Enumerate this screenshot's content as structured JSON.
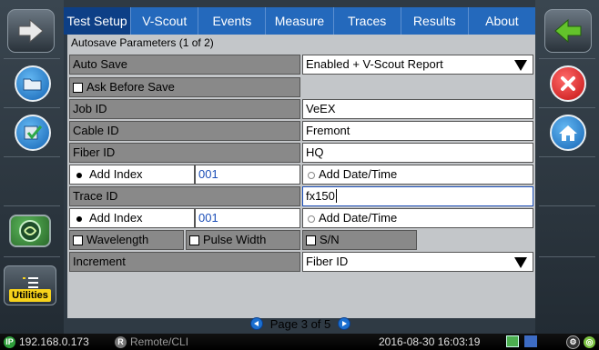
{
  "tabs": [
    "Test Setup",
    "V-Scout",
    "Events",
    "Measure",
    "Traces",
    "Results",
    "About"
  ],
  "section_title": "Autosave Parameters (1 of 2)",
  "auto_save": {
    "label": "Auto Save",
    "value": "Enabled + V-Scout Report"
  },
  "ask_before_save": {
    "label": "Ask Before Save"
  },
  "job_id": {
    "label": "Job ID",
    "value": "VeEX"
  },
  "cable_id": {
    "label": "Cable ID",
    "value": "Fremont"
  },
  "fiber_id": {
    "label": "Fiber ID",
    "value": "HQ"
  },
  "fiber_index": {
    "label": "Add Index",
    "value": "001",
    "date_label": "Add Date/Time"
  },
  "trace_id": {
    "label": "Trace ID",
    "value": "fx150"
  },
  "trace_index": {
    "label": "Add Index",
    "value": "001",
    "date_label": "Add Date/Time"
  },
  "options": {
    "wavelength": "Wavelength",
    "pulse_width": "Pulse Width",
    "sn": "S/N"
  },
  "increment": {
    "label": "Increment",
    "value": "Fiber ID"
  },
  "pager": {
    "text": "Page 3 of 5"
  },
  "utilities_label": "Utilities",
  "status": {
    "ip": "192.168.0.173",
    "remote": "Remote/CLI",
    "datetime": "2016-08-30 16:03:19"
  },
  "colors": {
    "tab": "#2469bc",
    "tab_active": "#0d3f86",
    "accent": "#f7d21b"
  }
}
